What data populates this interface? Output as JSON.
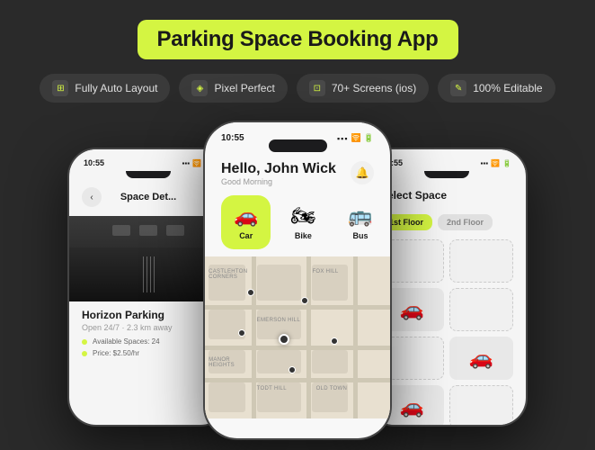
{
  "header": {
    "title": "Parking Space Booking App"
  },
  "features": [
    {
      "id": "auto-layout",
      "icon": "⊞",
      "label": "Fully Auto Layout"
    },
    {
      "id": "pixel-perfect",
      "icon": "◈",
      "label": "Pixel Perfect"
    },
    {
      "id": "screens",
      "icon": "⊡",
      "label": "70+ Screens (ios)"
    },
    {
      "id": "editable",
      "icon": "✎",
      "label": "100% Editable"
    }
  ],
  "phone_left": {
    "status_time": "10:55",
    "header_title": "Space Det...",
    "parking_name": "Horizon Parking",
    "parking_subtitle": "Open 24/7 · 2.3 km away"
  },
  "phone_center": {
    "status_time": "10:55",
    "greeting": "Hello, John Wick",
    "sub_greeting": "Good Morning",
    "vehicles": [
      {
        "id": "car",
        "icon": "🚗",
        "label": "Car",
        "active": true
      },
      {
        "id": "bike",
        "icon": "🏍",
        "label": "Bike",
        "active": false
      },
      {
        "id": "bus",
        "icon": "🚌",
        "label": "Bus",
        "active": false
      }
    ],
    "map_labels": [
      "CASTLEHTON CORNERS",
      "FOX HILL",
      "EMERSON HILL",
      "MANOR HEIGHTS",
      "TODT HILL",
      "OLD TOWN"
    ]
  },
  "phone_right": {
    "status_time": "10:55",
    "header_title": "Select Space",
    "floors": [
      {
        "label": "1st Floor",
        "active": true
      },
      {
        "label": "2nd Floor",
        "active": false
      }
    ]
  },
  "colors": {
    "accent": "#d4f542",
    "background": "#2a2a2a",
    "badge_bg": "#3a3a3a"
  }
}
